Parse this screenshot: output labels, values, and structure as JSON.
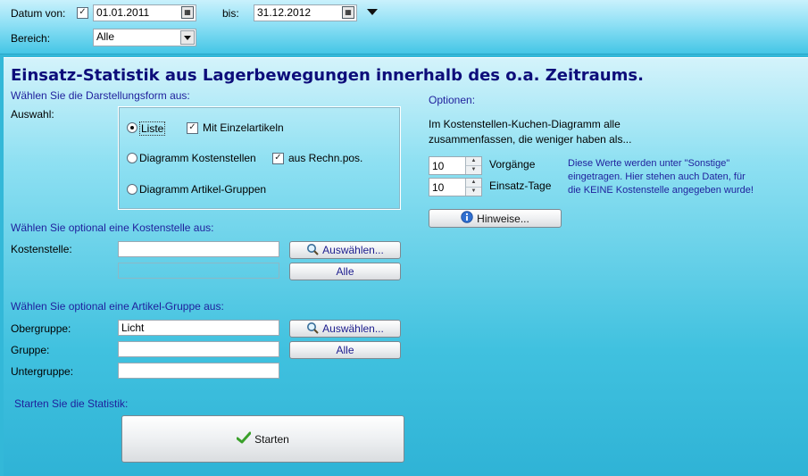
{
  "filter": {
    "datum_von_label": "Datum von:",
    "datum_von_checked": true,
    "datum_von_value": "01.01.2011",
    "bis_label": "bis:",
    "bis_value": "31.12.2012",
    "bereich_label": "Bereich:",
    "bereich_value": "Alle"
  },
  "main": {
    "title": "Einsatz-Statistik aus Lagerbewegungen innerhalb des o.a. Zeitraums.",
    "darstellung_heading": "Wählen Sie die Darstellungsform aus:",
    "auswahl_label": "Auswahl:",
    "options": {
      "liste": "Liste",
      "mit_einzelartikeln": "Mit Einzelartikeln",
      "mit_einzelartikeln_checked": true,
      "diagramm_kostenstellen": "Diagramm Kostenstellen",
      "aus_rechn_pos": "aus Rechn.pos.",
      "aus_rechn_pos_checked": true,
      "diagramm_artikel_gruppen": "Diagramm Artikel-Gruppen",
      "selected": "liste"
    },
    "kostenstelle_heading": "Wählen Sie optional eine Kostenstelle aus:",
    "kostenstelle_label": "Kostenstelle:",
    "kostenstelle_value": "",
    "kostenstelle_info": "",
    "auswaehlen_label": "Auswählen...",
    "alle_label": "Alle",
    "artikelgruppe_heading": "Wählen Sie optional eine Artikel-Gruppe aus:",
    "obergruppe_label": "Obergruppe:",
    "obergruppe_value": "Licht",
    "gruppe_label": "Gruppe:",
    "gruppe_value": "",
    "untergruppe_label": "Untergruppe:",
    "untergruppe_value": "",
    "starten_heading": "Starten Sie die Statistik:",
    "starten_label": "Starten"
  },
  "optionen": {
    "heading": "Optionen:",
    "description_line1": "Im Kostenstellen-Kuchen-Diagramm alle",
    "description_line2": "zusammenfassen, die weniger haben als...",
    "vorgaenge_value": "10",
    "vorgaenge_label": "Vorgänge",
    "einsatztage_value": "10",
    "einsatztage_label": "Einsatz-Tage",
    "note_line1": "Diese Werte werden unter \"Sonstige\"",
    "note_line2": "eingetragen. Hier stehen auch Daten, für",
    "note_line3": "die KEINE Kostenstelle angegeben wurde!",
    "hinweise_label": "Hinweise..."
  }
}
